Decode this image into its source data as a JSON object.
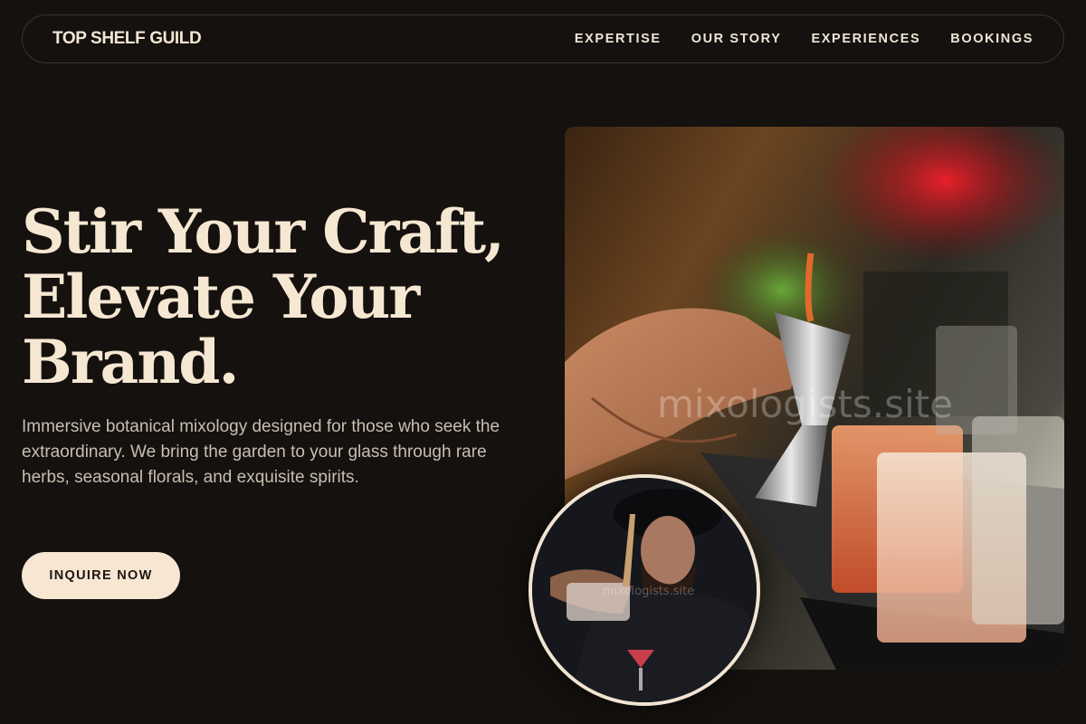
{
  "nav": {
    "brand": "TOP SHELF GUILD",
    "links": [
      "EXPERTISE",
      "OUR STORY",
      "EXPERIENCES",
      "BOOKINGS"
    ]
  },
  "hero": {
    "title_lines": [
      "Stir Your Craft,",
      "Elevate Your",
      "Brand."
    ],
    "description": "Immersive botanical mixology designed for those who seek the extraordinary. We bring the garden to your glass through rare herbs, seasonal florals, and exquisite spirits.",
    "cta_label": "INQUIRE NOW"
  },
  "images": {
    "main_watermark": "mixologists.site",
    "inset_watermark": "mixologists.site"
  },
  "colors": {
    "background": "#14110e",
    "accent_cream": "#f6e6d2",
    "text_muted": "#c9beb2"
  }
}
